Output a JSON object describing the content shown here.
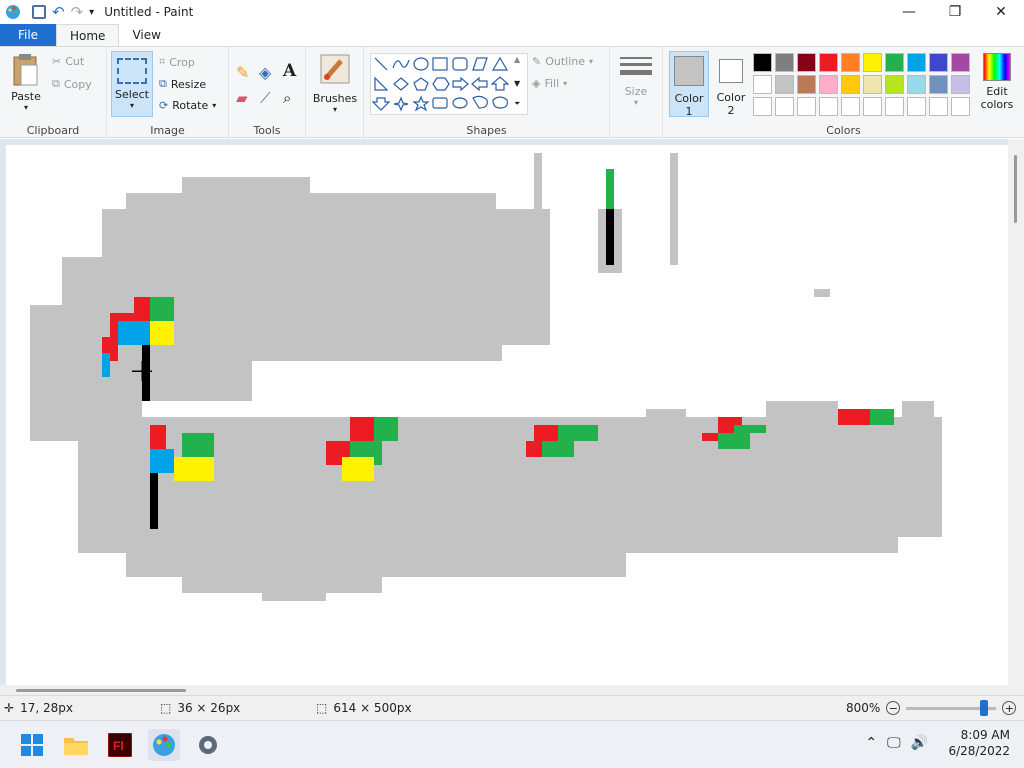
{
  "window": {
    "title": "Untitled - Paint",
    "min": "—",
    "max": "❐",
    "close": "✕"
  },
  "tabs": {
    "file": "File",
    "home": "Home",
    "view": "View"
  },
  "clipboard": {
    "paste": "Paste",
    "cut": "Cut",
    "copy": "Copy",
    "label": "Clipboard"
  },
  "image": {
    "select": "Select",
    "crop": "Crop",
    "resize": "Resize",
    "rotate": "Rotate",
    "label": "Image"
  },
  "tools": {
    "label": "Tools",
    "text_glyph": "A"
  },
  "brushes": {
    "label": "Brushes"
  },
  "shapes": {
    "outline": "Outline",
    "fill": "Fill",
    "label": "Shapes"
  },
  "size": {
    "label": "Size"
  },
  "colors": {
    "color1_label": "Color 1",
    "color1_line1": "Color",
    "color1_line2": "1",
    "color2_line1": "Color",
    "color2_line2": "2",
    "edit_line1": "Edit",
    "edit_line2": "colors",
    "label": "Colors",
    "color1": "#c3c3c3",
    "color2": "#ffffff",
    "palette_row1": [
      "#000000",
      "#7f7f7f",
      "#880015",
      "#ed1c24",
      "#ff7f27",
      "#fff200",
      "#22b14c",
      "#00a2e8",
      "#3f48cc",
      "#a349a4"
    ],
    "palette_row2": [
      "#ffffff",
      "#c3c3c3",
      "#b97a57",
      "#ffaec9",
      "#ffc90e",
      "#efe4b0",
      "#b5e61d",
      "#99d9ea",
      "#7092be",
      "#c8bfe7"
    ],
    "palette_row3": [
      "#ffffff",
      "#ffffff",
      "#ffffff",
      "#ffffff",
      "#ffffff",
      "#ffffff",
      "#ffffff",
      "#ffffff",
      "#ffffff",
      "#ffffff"
    ]
  },
  "status": {
    "position": "17, 28px",
    "selection": "36 × 26px",
    "canvas_size": "614 × 500px",
    "zoom": "800%"
  },
  "taskbar": {
    "time": "8:09 AM",
    "date": "6/28/2022"
  }
}
